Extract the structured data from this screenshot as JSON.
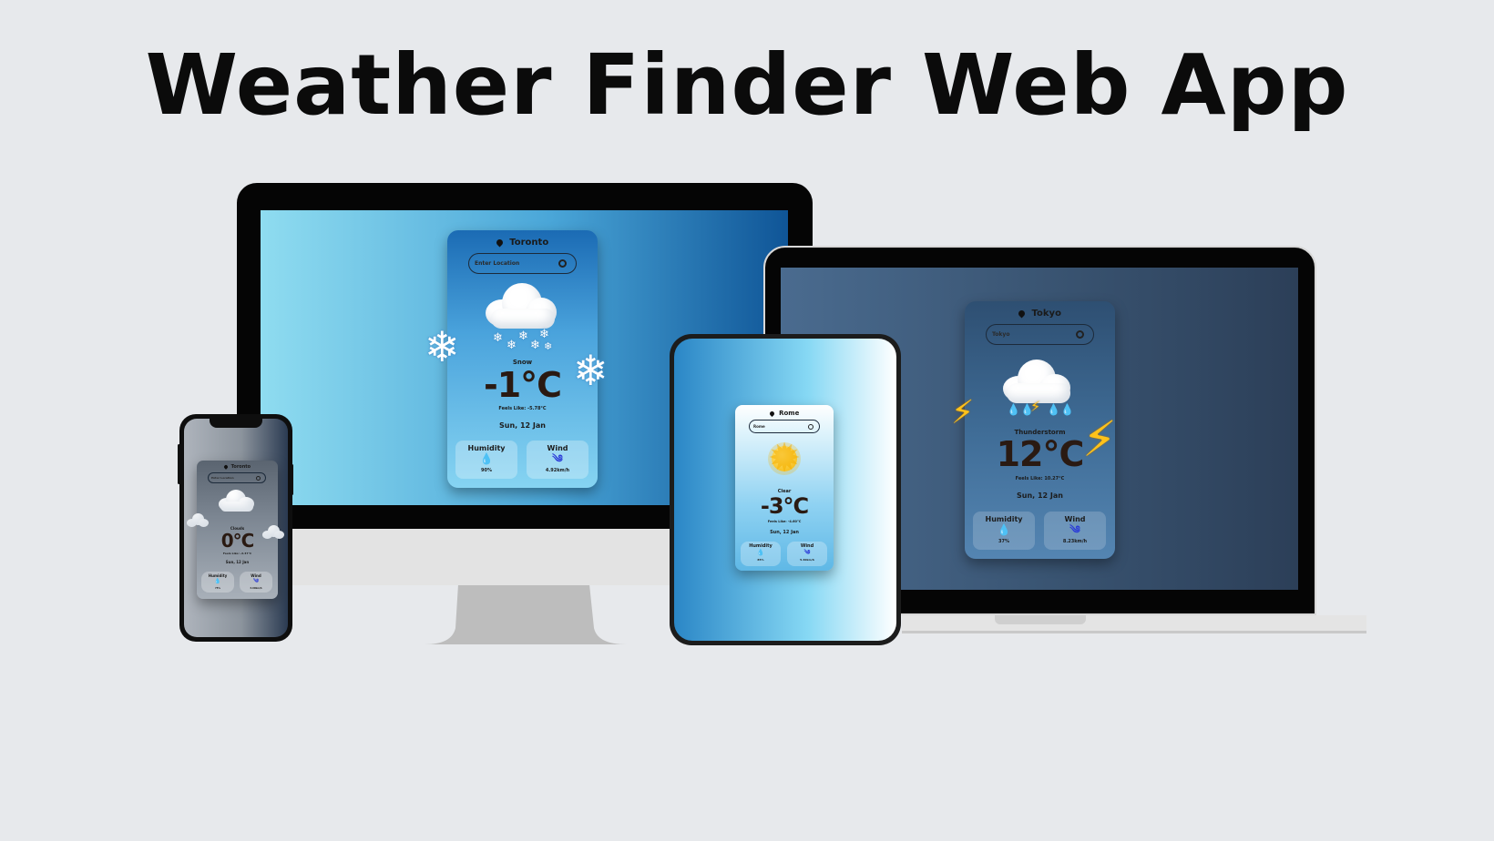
{
  "title": "Weather Finder Web App",
  "colors": {
    "background": "#e7e9ec",
    "title": "#0b0b0b",
    "accent_underline": "#6a3ad8",
    "icon_blue": "#2a3ad8",
    "bolt": "#ffc21a"
  },
  "desktop": {
    "location": "Toronto",
    "search_placeholder": "Enter Location",
    "condition": "Snow",
    "temperature": "-1°C",
    "feels_like": "Feels Like: -5.78°C",
    "date": "Sun, 12 Jan",
    "humidity_label": "Humidity",
    "humidity_value": "90%",
    "wind_label": "Wind",
    "wind_value": "4.92km/h",
    "icons": [
      "map-pin-icon",
      "search-icon",
      "snow-cloud-icon",
      "snowflake-icon",
      "water-drop-icon",
      "wind-icon"
    ]
  },
  "laptop": {
    "location": "Tokyo",
    "search_value": "Tokyo",
    "condition": "Thunderstorm",
    "temperature": "12°C",
    "feels_like": "Feels Like: 10.27°C",
    "date": "Sun, 12 Jan",
    "humidity_label": "Humidity",
    "humidity_value": "37%",
    "wind_label": "Wind",
    "wind_value": "8.23km/h",
    "icons": [
      "map-pin-icon",
      "search-icon",
      "storm-cloud-icon",
      "lightning-bolt-icon",
      "water-drop-icon",
      "wind-icon"
    ]
  },
  "tablet": {
    "location": "Rome",
    "search_value": "Rome",
    "condition": "Clear",
    "temperature": "-3°C",
    "feels_like": "Feels Like: -4.60°C",
    "date": "Sun, 12 Jan",
    "humidity_label": "Humidity",
    "humidity_value": "85%",
    "wind_label": "Wind",
    "wind_value": "5.40km/h",
    "icons": [
      "map-pin-icon",
      "search-icon",
      "sun-icon",
      "water-drop-icon",
      "wind-icon"
    ]
  },
  "phone": {
    "location": "Toronto",
    "search_placeholder": "Enter Location",
    "condition": "Clouds",
    "temperature": "0°C",
    "feels_like": "Feels Like: -4.37°C",
    "date": "Sun, 12 Jan",
    "humidity_label": "Humidity",
    "humidity_value": "75%",
    "wind_label": "Wind",
    "wind_value": "3.60km/h",
    "icons": [
      "map-pin-icon",
      "search-icon",
      "cloud-icon",
      "water-drop-icon",
      "wind-icon"
    ]
  }
}
